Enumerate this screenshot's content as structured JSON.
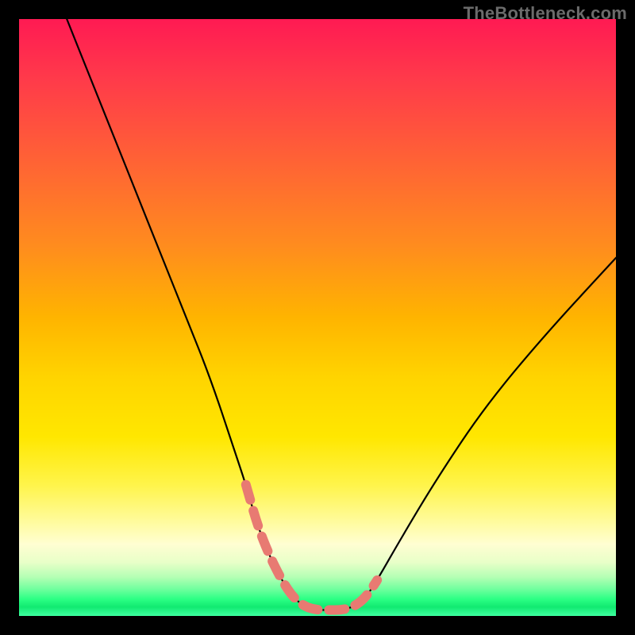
{
  "watermark": "TheBottleneck.com",
  "colors": {
    "frame": "#000000",
    "curve": "#000000",
    "marker": "#e87a72",
    "gradient_top": "#ff1a53",
    "gradient_mid": "#ffe700",
    "gradient_bottom": "#11ea71"
  },
  "chart_data": {
    "type": "line",
    "title": "",
    "xlabel": "",
    "ylabel": "",
    "xlim": [
      0,
      100
    ],
    "ylim": [
      0,
      100
    ],
    "grid": false,
    "legend": false,
    "description": "Single V-shaped bottleneck curve over a vertical red→yellow→green gradient. Y-axis reads as bottleneck percent (top=100, bottom=0). X-axis is an unlabeled parameter. A coral dashed segment highlights the near-zero-bottleneck valley.",
    "series": [
      {
        "name": "bottleneck-curve",
        "x": [
          8,
          12,
          16,
          20,
          24,
          28,
          32,
          36,
          38,
          40,
          42,
          44,
          46,
          48,
          50,
          52,
          54,
          56,
          58,
          60,
          64,
          70,
          78,
          88,
          100
        ],
        "y": [
          100,
          90,
          80,
          70,
          60,
          50,
          40,
          28,
          22,
          15,
          10,
          6,
          3,
          1.5,
          1,
          1,
          1,
          1.5,
          3,
          6,
          13,
          23,
          35,
          47,
          60
        ]
      }
    ],
    "highlight": {
      "name": "optimal-range",
      "x": [
        38,
        40,
        42,
        44,
        46,
        48,
        50,
        52,
        54,
        56,
        58,
        60
      ],
      "y": [
        22,
        15,
        10,
        6,
        3,
        1.5,
        1,
        1,
        1,
        1.5,
        3,
        6
      ],
      "style": "dashed",
      "color": "#e87a72"
    }
  }
}
